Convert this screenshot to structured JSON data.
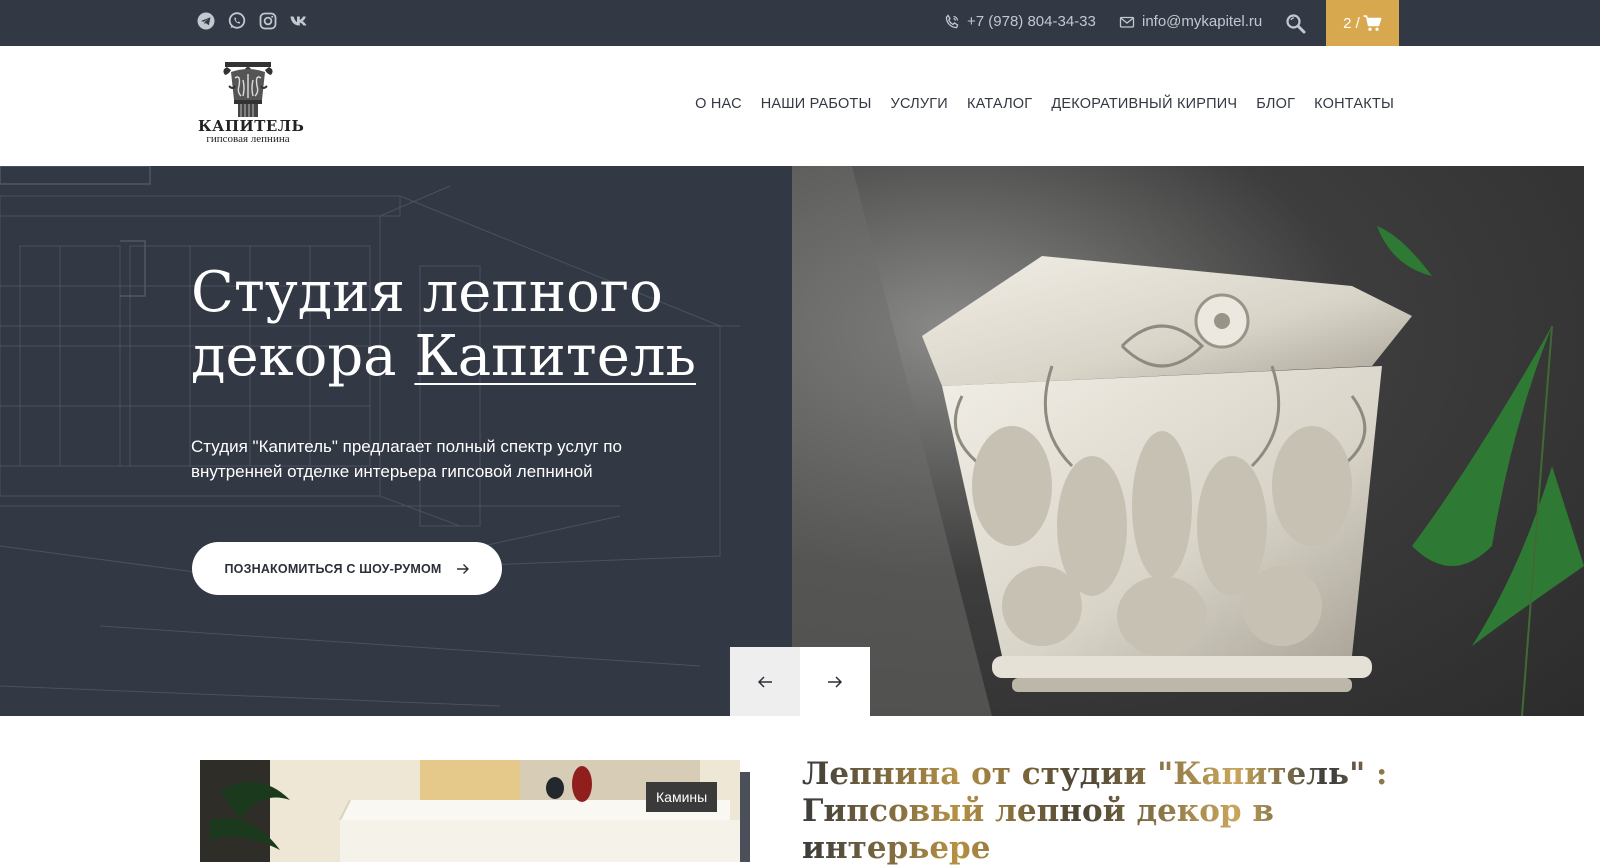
{
  "topbar": {
    "social": [
      "telegram-icon",
      "whatsapp-icon",
      "instagram-icon",
      "vk-icon"
    ],
    "phone": "+7 (978) 804-34-33",
    "email": "info@mykapitel.ru",
    "cart_count": "2 /"
  },
  "logo": {
    "title": "КАПИТЕЛЬ",
    "subtitle": "гипсовая лепнина"
  },
  "nav": {
    "items": [
      "О НАС",
      "НАШИ РАБОТЫ",
      "УСЛУГИ",
      "КАТАЛОГ",
      "ДЕКОРАТИВНЫЙ КИРПИЧ",
      "БЛОГ",
      "КОНТАКТЫ"
    ]
  },
  "hero": {
    "title_line1": "Студия лепного",
    "title_line2": "декора ",
    "title_accent": "Капитель",
    "text": "Студия \"Капитель\" предлагает полный спектр услуг по внутренней отделке интерьера гипсовой лепниной",
    "button": "ПОЗНАКОМИТЬСЯ С ШОУ-РУМОМ"
  },
  "section": {
    "thumb_label": "Камины",
    "title": "Лепнина от студии \"Капитель\" : Гипсовый лепной декор в интерьере"
  },
  "colors": {
    "dark": "#323844",
    "accent": "#d8a84e"
  }
}
